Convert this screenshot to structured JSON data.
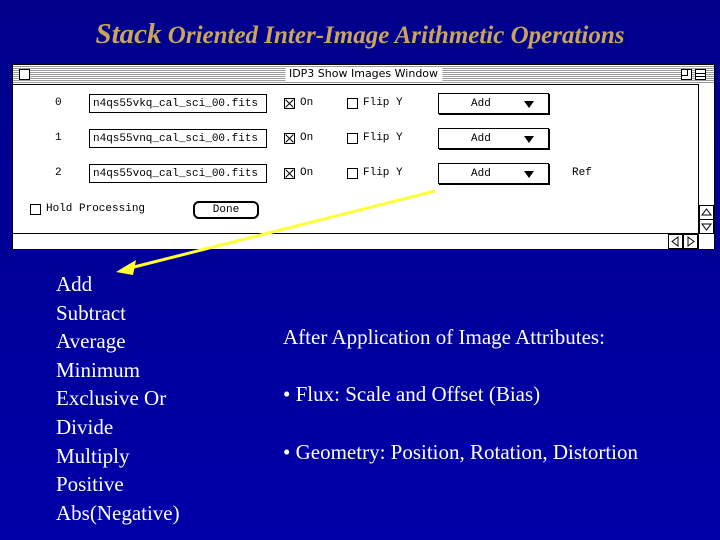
{
  "slide": {
    "title_stack": "Stack",
    "title_rest": " Oriented Inter-Image Arithmetic Operations"
  },
  "window": {
    "title": "IDP3 Show Images Window",
    "rows": [
      {
        "index": "0",
        "file": "n4qs55vkq_cal_sci_00.fits",
        "on_label": "On",
        "on_checked": true,
        "flip_label": "Flip Y",
        "flip_checked": false,
        "op": "Add",
        "ref": ""
      },
      {
        "index": "1",
        "file": "n4qs55vnq_cal_sci_00.fits",
        "on_label": "On",
        "on_checked": true,
        "flip_label": "Flip Y",
        "flip_checked": false,
        "op": "Add",
        "ref": ""
      },
      {
        "index": "2",
        "file": "n4qs55voq_cal_sci_00.fits",
        "on_label": "On",
        "on_checked": true,
        "flip_label": "Flip Y",
        "flip_checked": false,
        "op": "Add",
        "ref": "Ref"
      }
    ],
    "hold_label": "Hold Processing",
    "hold_checked": false,
    "done_label": "Done"
  },
  "operations": [
    "Add",
    "Subtract",
    "Average",
    "Minimum",
    "Exclusive Or",
    "Divide",
    "Multiply",
    "Positive",
    "Abs(Negative)"
  ],
  "attributes": {
    "heading": "After Application of Image Attributes:",
    "flux": "• Flux: Scale and Offset (Bias)",
    "geometry": "• Geometry: Position, Rotation, Distortion"
  },
  "colors": {
    "background": "#0000a8",
    "title": "#c8a55a",
    "arrow": "#ffff33"
  }
}
